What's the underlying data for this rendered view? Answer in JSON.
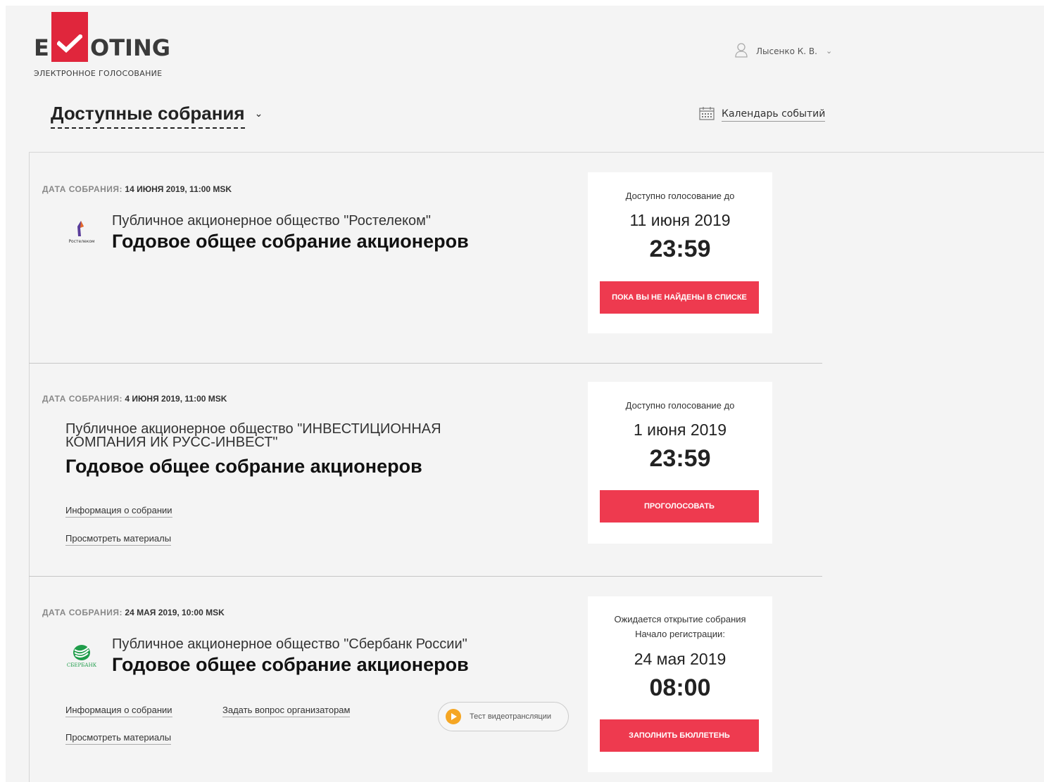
{
  "brand": {
    "logo_e": "E",
    "logo_rest": "OTING",
    "subtitle": "ЭЛЕКТРОННОЕ ГОЛОСОВАНИЕ",
    "accent": "#e0263c"
  },
  "user": {
    "name": "Лысенко К. В.",
    "icon": "user-icon"
  },
  "header": {
    "title": "Доступные собрания",
    "calendar_label": "Календарь событий"
  },
  "meetings": [
    {
      "date_label": "ДАТА СОБРАНИЯ:",
      "date_value": "14 ИЮНЯ 2019, 11:00 MSK",
      "logo_text": "Ростелеком",
      "company": "Публичное акционерное общество \"Ростелеком\"",
      "title": "Годовое общее собрание акционеров",
      "card_label": "Доступно голосование до",
      "card_date": "11 июня 2019",
      "card_time": "23:59",
      "button": "ПОКА ВЫ НЕ НАЙДЕНЫ В СПИСКЕ"
    },
    {
      "date_label": "ДАТА СОБРАНИЯ:",
      "date_value": "4 ИЮНЯ 2019, 11:00 MSK",
      "company_line1": "Публичное акционерное общество \"ИНВЕСТИЦИОННАЯ",
      "company_line2": "КОМПАНИЯ ИК РУСС-ИНВЕСТ\"",
      "title": "Годовое общее собрание акционеров",
      "link_info": "Информация о собрании",
      "link_materials": "Просмотреть материалы",
      "card_label": "Доступно голосование до",
      "card_date": "1 июня 2019",
      "card_time": "23:59",
      "button": "ПРОГОЛОСОВАТЬ"
    },
    {
      "date_label": "ДАТА СОБРАНИЯ:",
      "date_value": "24 МАЯ 2019, 10:00 MSK",
      "logo_text": "СБЕРБАНК",
      "company": "Публичное акционерное общество \"Сбербанк России\"",
      "title": "Годовое общее собрание акционеров",
      "link_info": "Информация о собрании",
      "link_question": "Задать вопрос организаторам",
      "link_materials": "Просмотреть материалы",
      "video_label": "Тест видеотрансляции",
      "card_label1": "Ожидается открытие собрания",
      "card_label2": "Начало регистрации:",
      "card_date": "24 мая 2019",
      "card_time": "08:00",
      "button": "ЗАПОЛНИТЬ БЮЛЛЕТЕНЬ"
    }
  ]
}
